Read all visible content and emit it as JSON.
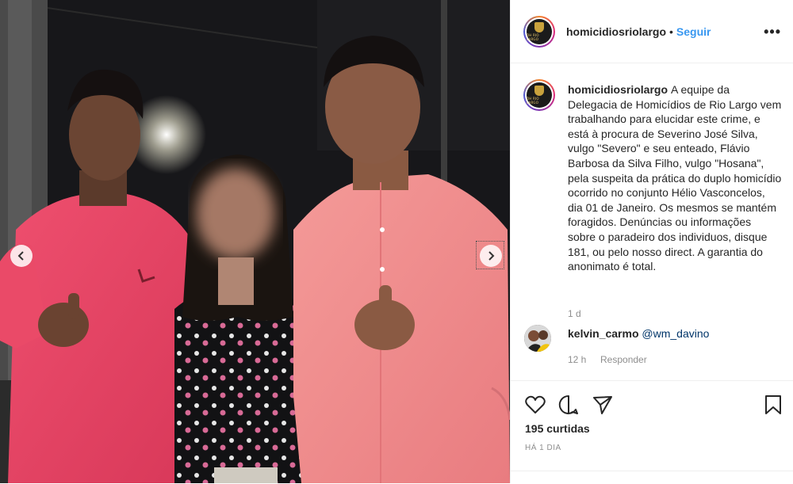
{
  "post": {
    "author": "homicidiosriolargo",
    "avatar_text": "DH RIO LARGO",
    "follow_label": "Seguir",
    "separator": "•",
    "more_label": "•••",
    "caption": "A equipe da Delegacia de Homicídios de Rio Largo vem trabalhando para elucidar este crime, e está à procura de Severino José Silva, vulgo \"Severo\" e seu enteado, Flávio Barbosa da Silva Filho, vulgo \"Hosana\", pela suspeita da prática do duplo homicídio ocorrido no conjunto Hélio Vasconcelos, dia 01 de Janeiro. Os mesmos se mantém foragidos. Denúncias ou informações sobre o paradeiro dos individuos, disque 181, ou pelo nosso direct. A garantia do anonimato é total.",
    "caption_time": "1 d",
    "likes": "195 curtidas",
    "posted": "HÁ 1 DIA"
  },
  "comments": [
    {
      "user": "kelvin_carmo",
      "text": "@wm_davino",
      "time": "12 h",
      "reply_label": "Responder"
    }
  ],
  "icons": {
    "prev": "chevron-left-icon",
    "next": "chevron-right-icon",
    "like": "heart-icon",
    "comment": "comment-icon",
    "share": "paper-plane-icon",
    "save": "bookmark-icon"
  },
  "colors": {
    "accent": "#3897f0",
    "shirt": "#f08a8c",
    "secondary_text": "#8e8e8e"
  }
}
